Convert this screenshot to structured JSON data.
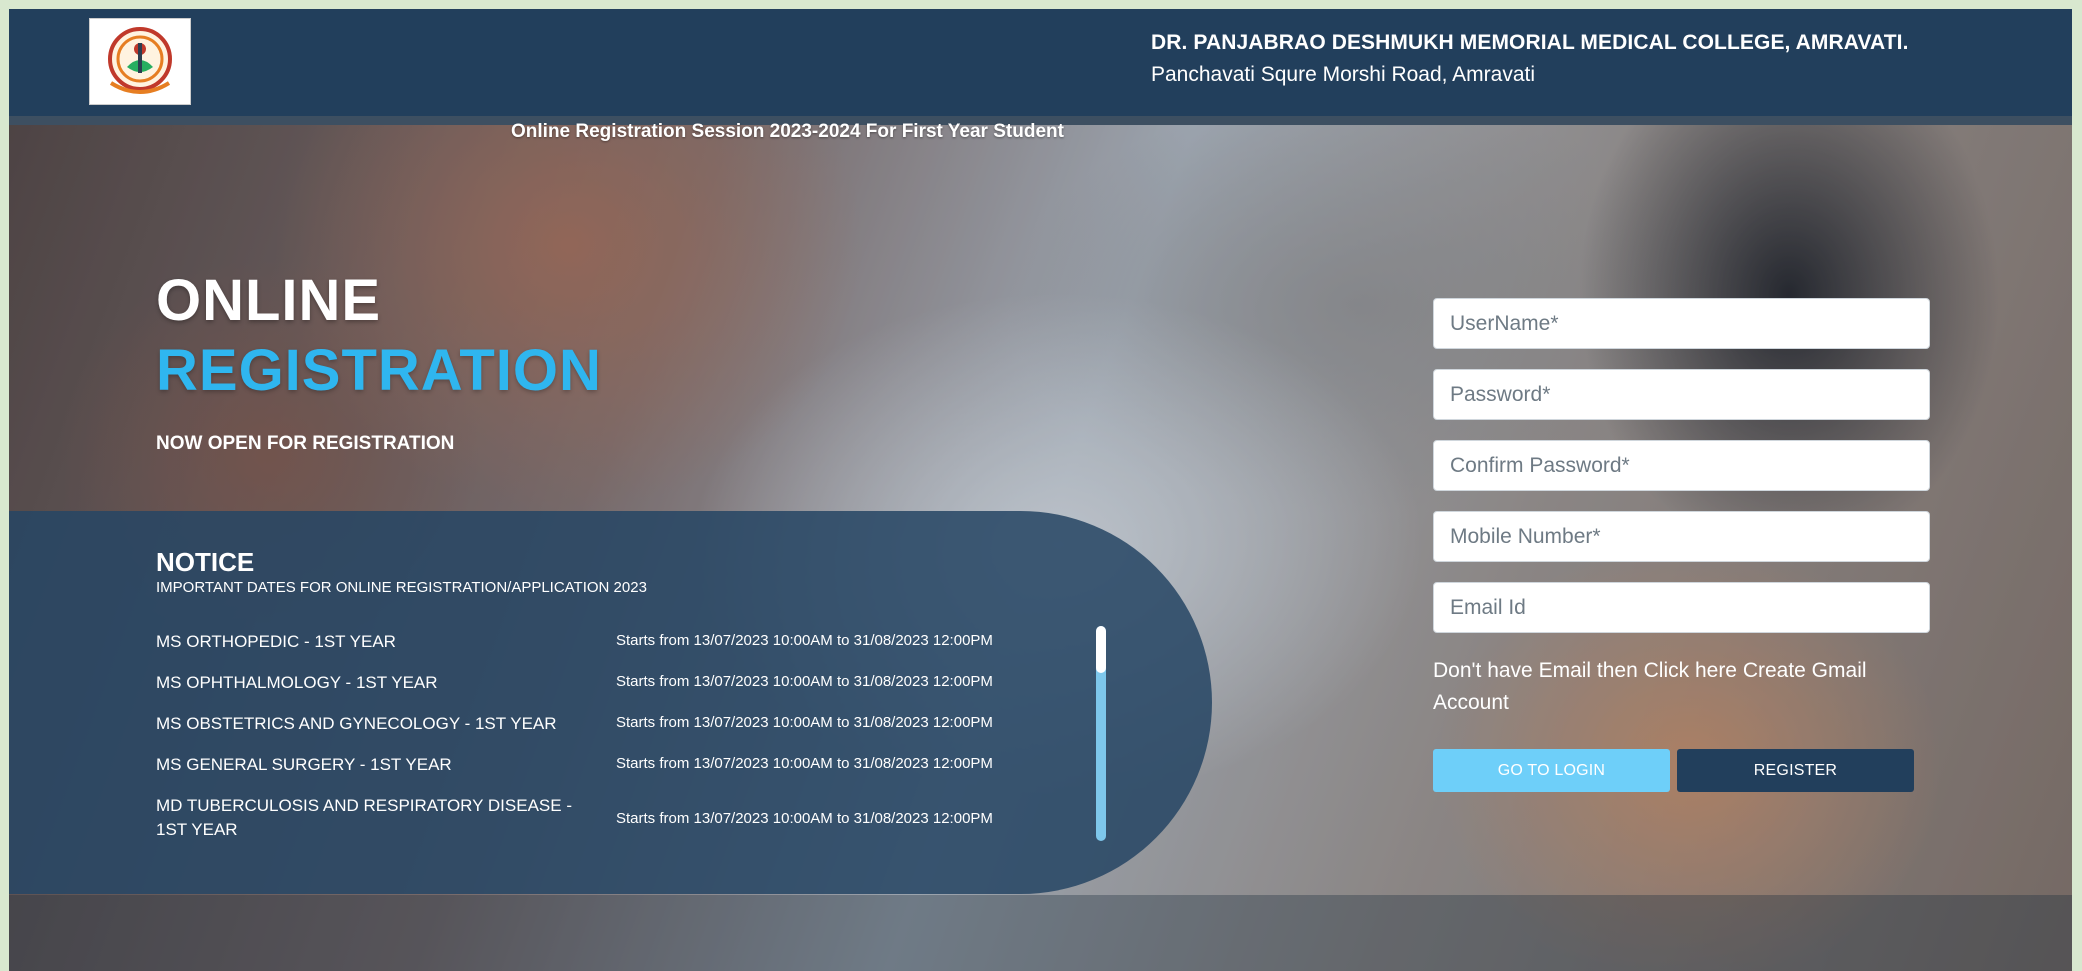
{
  "header": {
    "college_name": "DR. PANJABRAO DESHMUKH MEMORIAL MEDICAL COLLEGE, AMRAVATI.",
    "address": "Panchavati Squre Morshi Road, Amravati",
    "logo_icon": "college-emblem-icon"
  },
  "session_title": "Online Registration Session 2023-2024 For First Year Student",
  "hero": {
    "line1": "ONLINE",
    "line2": "REGISTRATION",
    "subtitle": "NOW OPEN FOR REGISTRATION"
  },
  "notice": {
    "title": "NOTICE",
    "subtitle": "IMPORTANT DATES FOR ONLINE REGISTRATION/APPLICATION 2023",
    "items": [
      {
        "course": "MS ORTHOPEDIC - 1ST YEAR",
        "dates": "Starts from 13/07/2023 10:00AM to 31/08/2023 12:00PM"
      },
      {
        "course": "MS OPHTHALMOLOGY - 1ST YEAR",
        "dates": "Starts from 13/07/2023 10:00AM to 31/08/2023 12:00PM"
      },
      {
        "course": "MS OBSTETRICS AND GYNECOLOGY - 1ST YEAR",
        "dates": "Starts from 13/07/2023 10:00AM to 31/08/2023 12:00PM"
      },
      {
        "course": "MS GENERAL SURGERY - 1ST YEAR",
        "dates": "Starts from 13/07/2023 10:00AM to 31/08/2023 12:00PM"
      },
      {
        "course": "MD TUBERCULOSIS AND RESPIRATORY DISEASE - 1ST YEAR",
        "dates": "Starts from 13/07/2023 10:00AM to 31/08/2023 12:00PM"
      }
    ]
  },
  "form": {
    "username_placeholder": "UserName*",
    "password_placeholder": "Password*",
    "confirm_password_placeholder": "Confirm Password*",
    "mobile_placeholder": "Mobile Number*",
    "email_placeholder": "Email Id",
    "gmail_note": "Don't have Email then Click here Create Gmail Account",
    "login_label": "GO TO LOGIN",
    "register_label": "REGISTER"
  },
  "colors": {
    "header_bg": "#223f5c",
    "accent_blue": "#2fb6ef",
    "login_button": "#6ecff9",
    "register_button": "#223f5c"
  }
}
